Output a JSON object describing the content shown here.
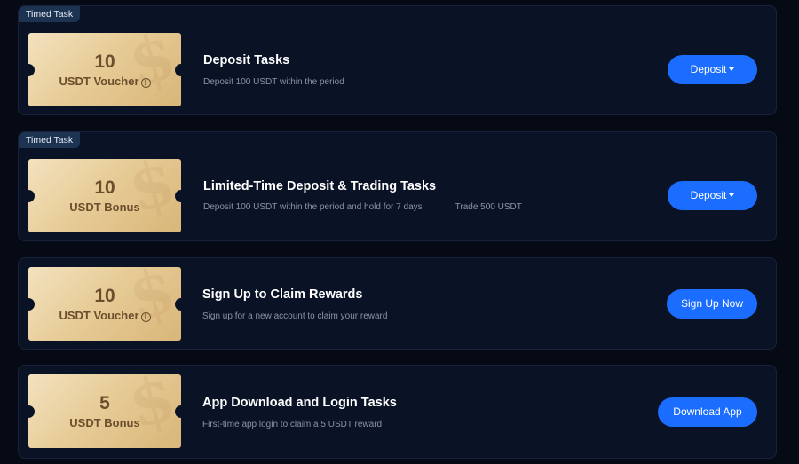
{
  "tasks": [
    {
      "tag": "Timed Task",
      "voucher_amount": "10",
      "voucher_unit": "USDT Voucher",
      "voucher_info_icon": "info-circle-icon",
      "title": "Deposit Tasks",
      "desc": "Deposit 100 USDT within the period",
      "button": "Deposit"
    },
    {
      "tag": "Timed Task",
      "voucher_amount": "10",
      "voucher_unit": "USDT Bonus",
      "title": "Limited-Time Deposit & Trading Tasks",
      "desc": "Deposit 100 USDT within the period and hold for 7 days",
      "desc2": "Trade 500 USDT",
      "button": "Deposit"
    },
    {
      "voucher_amount": "10",
      "voucher_unit": "USDT Voucher",
      "voucher_info_icon": "info-circle-icon",
      "title": "Sign Up to Claim Rewards",
      "desc": "Sign up for a new account to claim your reward",
      "button": "Sign Up Now"
    },
    {
      "voucher_amount": "5",
      "voucher_unit": "USDT Bonus",
      "title": "App Download and Login Tasks",
      "desc": "First-time app login to claim a 5 USDT reward",
      "button": "Download App"
    }
  ],
  "colors": {
    "background": "#050a14",
    "card": "#0a1326",
    "button": "#1a6dff",
    "voucher_gold": "#e7cc97",
    "tag": "#1d3352"
  }
}
